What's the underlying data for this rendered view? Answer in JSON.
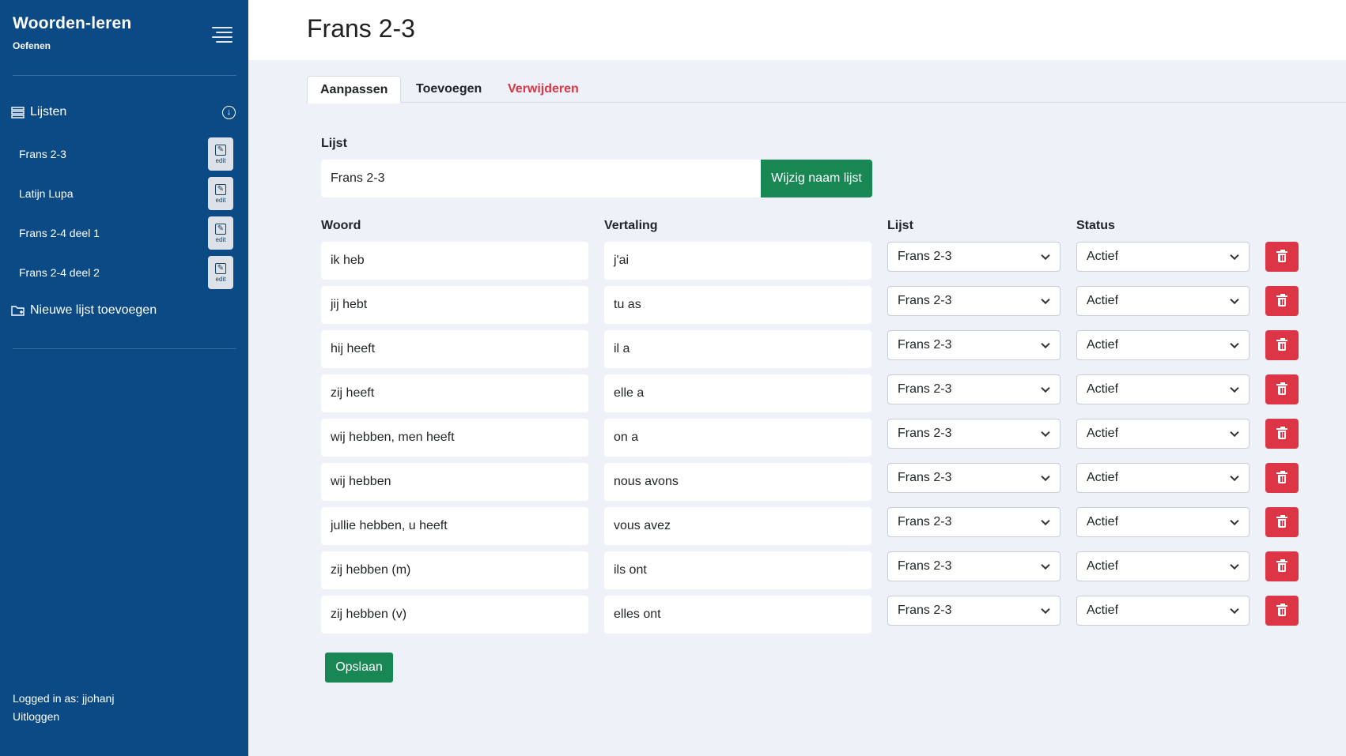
{
  "app": {
    "title": "Woorden-leren",
    "subtitle": "Oefenen"
  },
  "sidebar": {
    "lists_label": "Lijsten",
    "items": [
      {
        "name": "Frans 2-3",
        "edit": "edit"
      },
      {
        "name": "Latijn Lupa",
        "edit": "edit"
      },
      {
        "name": "Frans 2-4 deel 1",
        "edit": "edit"
      },
      {
        "name": "Frans 2-4 deel 2",
        "edit": "edit"
      }
    ],
    "new_list": "Nieuwe lijst toevoegen",
    "logged_in": "Logged in as: jjohanj",
    "logout": "Uitloggen"
  },
  "page": {
    "title": "Frans 2-3"
  },
  "tabs": [
    {
      "label": "Aanpassen",
      "active": true
    },
    {
      "label": "Toevoegen",
      "active": false
    },
    {
      "label": "Verwijderen",
      "active": false,
      "color": "#dc3545"
    }
  ],
  "form": {
    "list_label": "Lijst",
    "list_value": "Frans 2-3",
    "rename_button": "Wijzig naam lijst",
    "columns": {
      "word": "Woord",
      "translation": "Vertaling",
      "list": "Lijst",
      "status": "Status"
    },
    "rows": [
      {
        "word": "ik heb",
        "translation": "j'ai",
        "list": "Frans 2-3",
        "status": "Actief"
      },
      {
        "word": "jij hebt",
        "translation": "tu as",
        "list": "Frans 2-3",
        "status": "Actief"
      },
      {
        "word": "hij heeft",
        "translation": "il a",
        "list": "Frans 2-3",
        "status": "Actief"
      },
      {
        "word": "zij heeft",
        "translation": "elle a",
        "list": "Frans 2-3",
        "status": "Actief"
      },
      {
        "word": "wij hebben, men heeft",
        "translation": "on a",
        "list": "Frans 2-3",
        "status": "Actief"
      },
      {
        "word": "wij hebben",
        "translation": "nous avons",
        "list": "Frans 2-3",
        "status": "Actief"
      },
      {
        "word": "jullie hebben, u heeft",
        "translation": "vous avez",
        "list": "Frans 2-3",
        "status": "Actief"
      },
      {
        "word": "zij hebben (m)",
        "translation": "ils ont",
        "list": "Frans 2-3",
        "status": "Actief"
      },
      {
        "word": "zij hebben (v)",
        "translation": "elles ont",
        "list": "Frans 2-3",
        "status": "Actief"
      }
    ],
    "save_button": "Opslaan"
  },
  "colors": {
    "sidebar": "#0b4a84",
    "green": "#198754",
    "red": "#dc3545",
    "background": "#eef1f8"
  },
  "icons": {
    "menu": "hamburger-icon",
    "lists": "list-icon",
    "collapse": "arrow-down-circle-icon",
    "edit": "pencil-square-icon",
    "new_list": "folder-plus-icon",
    "delete": "trash-icon",
    "dropdown": "chevron-down-icon"
  }
}
